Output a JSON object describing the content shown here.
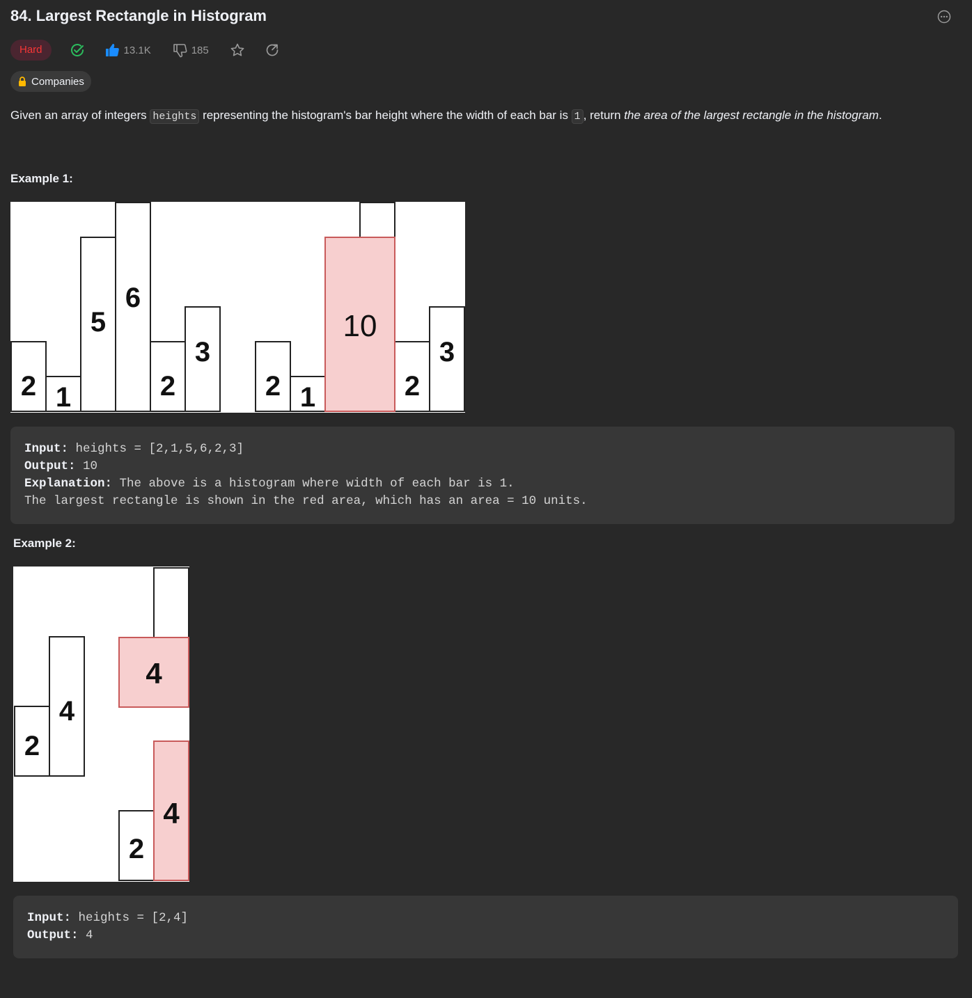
{
  "title": "84. Largest Rectangle in Histogram",
  "difficulty": "Hard",
  "likes": "13.1K",
  "dislikes": "185",
  "companies_label": "Companies",
  "description": {
    "p1": "Given an array of integers ",
    "code1": "heights",
    "p2": " representing the histogram's bar height where the width of each bar is ",
    "code2": "1",
    "p3": ", return ",
    "em": "the area of the largest rectangle in the histogram",
    "p4": "."
  },
  "example1": {
    "heading": "Example 1:",
    "input_label": "Input:",
    "input_value": " heights = [2,1,5,6,2,3]",
    "output_label": "Output:",
    "output_value": " 10",
    "explanation_label": "Explanation:",
    "explanation_line1": " The above is a histogram where width of each bar is 1.",
    "explanation_line2": "The largest rectangle is shown in the red area, which has an area = 10 units.",
    "figure": {
      "left_values": [
        2,
        1,
        5,
        6,
        2,
        3
      ],
      "right_values": [
        2,
        1,
        5,
        6,
        2,
        3
      ],
      "right_labels": [
        "2",
        "1",
        "",
        "10",
        "2",
        "3"
      ],
      "highlight": "10"
    }
  },
  "example2": {
    "heading": "Example 2:",
    "input_label": "Input:",
    "input_value": " heights = [2,4]",
    "output_label": "Output:",
    "output_value": " 4",
    "figure": {
      "values": [
        2,
        4
      ],
      "highlight_labels": [
        "4",
        "4",
        "2"
      ]
    }
  },
  "colors": {
    "bg": "#282828",
    "hard": "#f63636",
    "solved": "#2cbb5d",
    "like": "#1a8cff",
    "highlight_fill": "#f7cfcf",
    "highlight_stroke": "#c85a5a"
  }
}
